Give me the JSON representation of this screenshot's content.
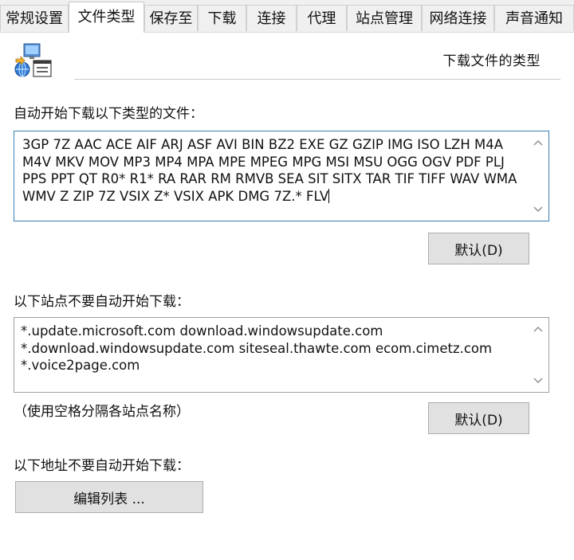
{
  "tabs": [
    {
      "label": "常规设置",
      "active": false
    },
    {
      "label": "文件类型",
      "active": true
    },
    {
      "label": "保存至",
      "active": false
    },
    {
      "label": "下载",
      "active": false
    },
    {
      "label": "连接",
      "active": false
    },
    {
      "label": "代理",
      "active": false
    },
    {
      "label": "站点管理",
      "active": false
    },
    {
      "label": "网络连接",
      "active": false
    },
    {
      "label": "声音通知",
      "active": false
    }
  ],
  "header": {
    "title": "下载文件的类型",
    "icon": "network-computer-icon"
  },
  "file_types": {
    "label": "自动开始下载以下类型的文件：",
    "value": "3GP 7Z AAC ACE AIF ARJ ASF AVI BIN BZ2 EXE GZ GZIP IMG ISO LZH M4A M4V MKV MOV MP3 MP4 MPA MPE MPEG MPG MSI MSU OGG OGV PDF PLJ PPS PPT QT R0* R1* RA RAR RM RMVB SEA SIT SITX TAR TIF TIFF WAV WMA WMV Z ZIP 7Z VSIX Z* VSIX APK DMG 7Z.* FLV",
    "default_button": "默认(D)"
  },
  "sites": {
    "label": "以下站点不要自动开始下载：",
    "value": "*.update.microsoft.com download.windowsupdate.com\n*.download.windowsupdate.com siteseal.thawte.com ecom.cimetz.com\n*.voice2page.com",
    "hint": "（使用空格分隔各站点名称）",
    "default_button": "默认(D)"
  },
  "addresses": {
    "label": "以下地址不要自动开始下载：",
    "edit_button": "编辑列表 ..."
  },
  "colors": {
    "window_bg": "#ffffff",
    "tab_bg": "#f0f0f0",
    "button_bg": "#e1e1e1",
    "focus_border": "#3c7fb1"
  }
}
